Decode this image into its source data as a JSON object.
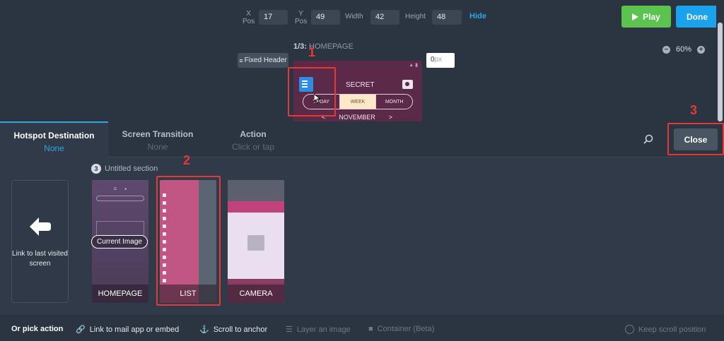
{
  "toolbar": {
    "x_label": "X\nPos",
    "x_value": "17",
    "y_label": "Y\nPos",
    "y_value": "49",
    "width_label": "Width",
    "width_value": "42",
    "height_label": "Height",
    "height_value": "48",
    "hide_label": "Hide",
    "play_label": "Play",
    "done_label": "Done"
  },
  "canvas": {
    "screen_index": "1/3:",
    "screen_name": "HOMEPAGE",
    "fixed_header_label": "Fixed Header",
    "px_placeholder": "px",
    "px_value": "0",
    "zoom_value": "60%",
    "phone": {
      "title": "SECRET",
      "segments": [
        "TODAY",
        "WEEK",
        "MONTH"
      ],
      "month": "NOVEMBER",
      "prev": "<",
      "next": ">"
    }
  },
  "annotations": [
    "1",
    "2",
    "3"
  ],
  "tabs": [
    {
      "title": "Hotspot Destination",
      "value": "None"
    },
    {
      "title": "Screen Transition",
      "value": "None"
    },
    {
      "title": "Action",
      "value": "Click or tap"
    }
  ],
  "close_label": "Close",
  "link_card": {
    "text": "Link to last visited screen"
  },
  "section": {
    "count": "3",
    "title": "Untitled section"
  },
  "screens": [
    {
      "name": "HOMEPAGE",
      "current_label": "Current Image"
    },
    {
      "name": "LIST"
    },
    {
      "name": "CAMERA"
    }
  ],
  "actions": {
    "label": "Or pick action",
    "items": [
      "Link to mail app or embed",
      "Scroll to anchor",
      "Layer an image",
      "Container (Beta)"
    ],
    "keep_scroll": "Keep scroll position"
  },
  "colors": {
    "accent": "#2ba7e9",
    "play": "#5cc34e",
    "done": "#1aa3ec",
    "annotation": "#e53935"
  }
}
